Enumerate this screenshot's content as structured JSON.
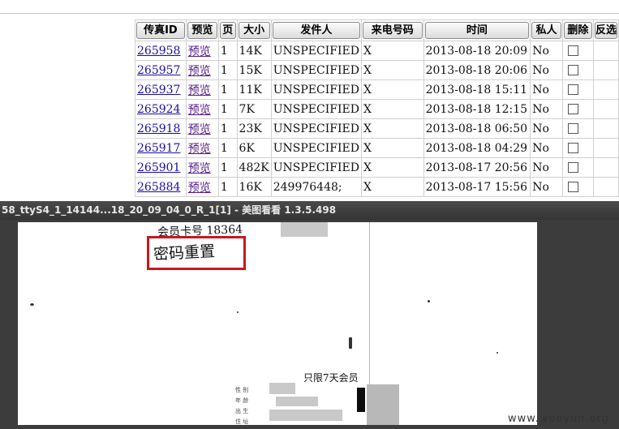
{
  "table": {
    "headers": [
      "传真ID",
      "预览",
      "页",
      "大小",
      "发件人",
      "来电号码",
      "时间",
      "私人",
      "删除",
      "反选"
    ],
    "rows": [
      {
        "id": "265958",
        "preview": "预览",
        "pages": "1",
        "size": "14K",
        "sender": "UNSPECIFIED",
        "caller": "X",
        "time": "2013-08-18  20:09",
        "private": "No"
      },
      {
        "id": "265957",
        "preview": "预览",
        "pages": "1",
        "size": "15K",
        "sender": "UNSPECIFIED",
        "caller": "X",
        "time": "2013-08-18  20:06",
        "private": "No"
      },
      {
        "id": "265937",
        "preview": "预览",
        "pages": "1",
        "size": "11K",
        "sender": "UNSPECIFIED",
        "caller": "X",
        "time": "2013-08-18  15:11",
        "private": "No"
      },
      {
        "id": "265924",
        "preview": "预览",
        "pages": "1",
        "size": "7K",
        "sender": "UNSPECIFIED",
        "caller": "X",
        "time": "2013-08-18  12:15",
        "private": "No"
      },
      {
        "id": "265918",
        "preview": "预览",
        "pages": "1",
        "size": "23K",
        "sender": "UNSPECIFIED",
        "caller": "X",
        "time": "2013-08-18  06:50",
        "private": "No"
      },
      {
        "id": "265917",
        "preview": "预览",
        "pages": "1",
        "size": "6K",
        "sender": "UNSPECIFIED",
        "caller": "X",
        "time": "2013-08-18  04:29",
        "private": "No"
      },
      {
        "id": "265901",
        "preview": "预览",
        "pages": "1",
        "size": "482K",
        "sender": "UNSPECIFIED",
        "caller": "X",
        "time": "2013-08-17  20:56",
        "private": "No"
      },
      {
        "id": "265884",
        "preview": "预览",
        "pages": "1",
        "size": "16K",
        "sender": "249976448;",
        "caller": "X",
        "time": "2013-08-17  15:56",
        "private": "No"
      }
    ]
  },
  "viewer": {
    "title": "58_ttyS4_1_14144...18_20_09_04_0_R_1[1] - 美图看看 1.3.5.498",
    "handwriting": {
      "line1": "会员卡号 18364",
      "line2": "密码重置",
      "line3": "只限7天会员"
    },
    "colors": {
      "highlight": "#c8171d",
      "title_bar": "#3c3c3c"
    }
  },
  "watermark": "www.wooyun.org"
}
